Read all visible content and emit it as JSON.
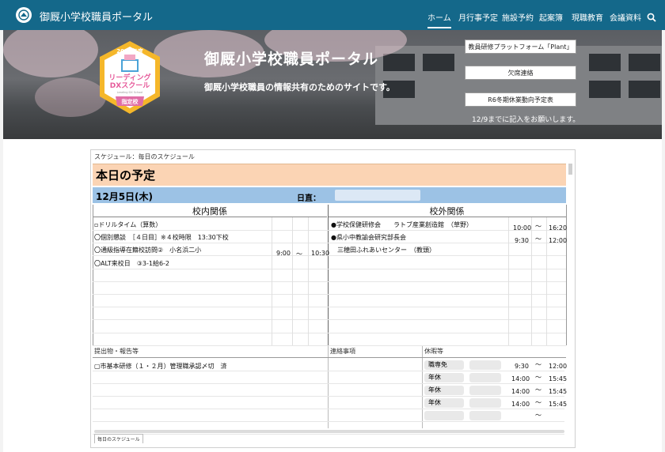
{
  "header": {
    "site_title": "御厩小学校職員ポータル",
    "nav": [
      "ホーム",
      "月行事予定",
      "施設予約",
      "起案簿",
      "現職教育",
      "会議資料"
    ],
    "active_nav": "ホーム"
  },
  "hero": {
    "title": "御厩小学校職員ポータル",
    "subtitle": "御厩小学校職員の情報共有のためのサイトです。",
    "badge": {
      "year": "2024年度",
      "line1": "リーディング",
      "line2": "DXスクール",
      "line3": "Leading DX School",
      "ribbon": "指定校"
    },
    "buttons": [
      "教員研修プラットフォーム「Plant」",
      "欠席連絡",
      "R6冬期休業動向予定表"
    ],
    "note": "12/9までに記入をお願いします。"
  },
  "schedule": {
    "breadcrumb": "スケジュール：毎日のスケジュール",
    "heading": "本日の予定",
    "date": "12月5日(木)",
    "duty_label": "日直：",
    "in_school_header": "校内関係",
    "out_school_header": "校外関係",
    "in_school": [
      {
        "text": "▫ドリルタイム（算数）",
        "start": "",
        "sep": "",
        "end": ""
      },
      {
        "text": "〇個別懇談　［４日目］※４校時限　13:30下校",
        "start": "",
        "sep": "",
        "end": ""
      },
      {
        "text": "〇通級指導在籍校訪問②　小名浜二小",
        "start": "9:00",
        "sep": "〜",
        "end": "10:30"
      },
      {
        "text": "〇ALT来校日　③3-1給6-2",
        "start": "",
        "sep": "",
        "end": ""
      }
    ],
    "out_school": [
      {
        "text": "●学校保健研修会　　ラトブ産業創造館　（草野）",
        "start": "10:00",
        "sep": "〜",
        "end": "16:20"
      },
      {
        "text": "●県小中教諭会研究部長会",
        "start": "9:30",
        "sep": "〜",
        "end": "12:00"
      },
      {
        "text": "　三穂田ふれあいセンター　（教頭）",
        "start": "",
        "sep": "",
        "end": ""
      }
    ],
    "sub_headers": {
      "submit": "提出物・報告等",
      "contact": "連絡事項",
      "leave": "休暇等"
    },
    "submit_items": [
      "▢市基本研修（１・２月）管理職承認〆切　済"
    ],
    "leave": [
      {
        "type": "職専免",
        "start": "9:30",
        "sep": "〜",
        "end": "12:00"
      },
      {
        "type": "年休",
        "start": "14:00",
        "sep": "〜",
        "end": "15:45"
      },
      {
        "type": "年休",
        "start": "14:00",
        "sep": "〜",
        "end": "15:45"
      },
      {
        "type": "年休",
        "start": "14:00",
        "sep": "〜",
        "end": "15:45"
      },
      {
        "type": "",
        "start": "",
        "sep": "〜",
        "end": ""
      }
    ],
    "sheet_tab": "毎日のスケジュール"
  },
  "colors": {
    "nav_bg": "#14688a",
    "today_bg": "#fbd4b4",
    "date_bg": "#9cc2e5",
    "badge_ring": "#f5b72a",
    "badge_ribbon": "#e06ea6"
  }
}
